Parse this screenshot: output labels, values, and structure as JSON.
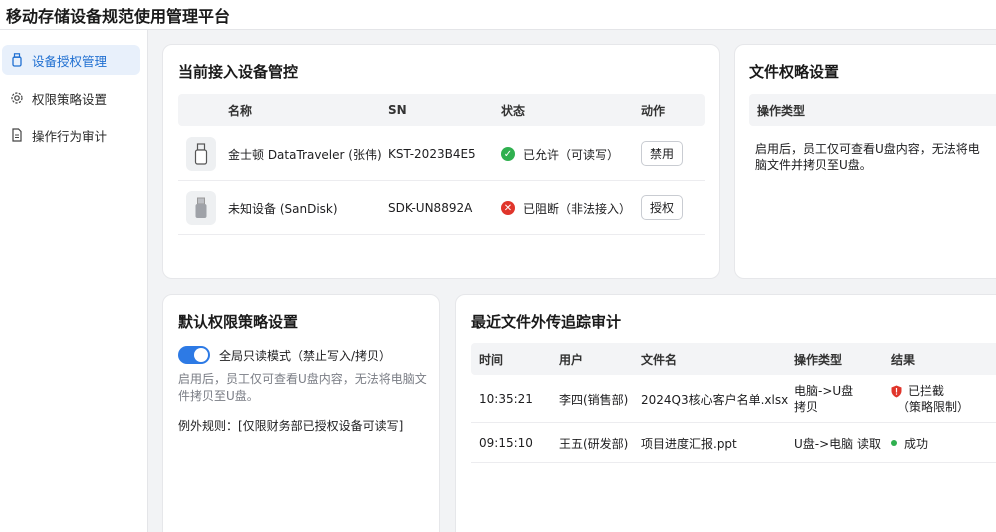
{
  "app": {
    "title": "移动存储设备规范使用管理平台"
  },
  "sidebar": {
    "items": [
      {
        "label": "设备授权管理",
        "icon": "usb-drive-icon",
        "active": true
      },
      {
        "label": "权限策略设置",
        "icon": "gear-icon",
        "active": false
      },
      {
        "label": "操作行为审计",
        "icon": "document-icon",
        "active": false
      }
    ]
  },
  "devices": {
    "title": "当前接入设备管控",
    "headers": {
      "name": "名称",
      "sn": "SN",
      "status": "状态",
      "action": "动作"
    },
    "rows": [
      {
        "name": "金士顿 DataTraveler (张伟)",
        "sn": "KST-2023B4E5",
        "status": "已允许（可读写）",
        "status_type": "allowed",
        "action": "禁用"
      },
      {
        "name": "未知设备 (SanDisk)",
        "sn": "SDK-UN8892A",
        "status": "已阻断（非法接入）",
        "status_type": "blocked",
        "action": "授权"
      }
    ]
  },
  "file_policy": {
    "title": "文件权略设置",
    "header": "操作类型",
    "description": "启用后，员工仅可查看U盘内容，无法将电脑文件并拷贝至U盘。"
  },
  "default_policy": {
    "title": "默认权限策略设置",
    "toggle_label": "全局只读模式（禁止写入/拷贝）",
    "toggle_on": true,
    "description": "启用后，员工仅可查看U盘内容，无法将电脑文件拷贝至U盘。",
    "exception": "例外规则：[仅限财务部已授权设备可读写]"
  },
  "audit": {
    "title": "最近文件外传追踪审计",
    "headers": {
      "time": "时间",
      "user": "用户",
      "file": "文件名",
      "op": "操作类型",
      "result": "结果"
    },
    "rows": [
      {
        "time": "10:35:21",
        "user": "李四(销售部)",
        "file": "2024Q3核心客户名单.xlsx",
        "op_line1": "电脑->U盘",
        "op_line2": "拷贝",
        "result_line1": "已拦截",
        "result_line2": "（策略限制）",
        "result_type": "blocked"
      },
      {
        "time": "09:15:10",
        "user": "王五(研发部)",
        "file": "项目进度汇报.ppt",
        "op_line1": "U盘->电脑 读取",
        "op_line2": "",
        "result_line1": "成功",
        "result_line2": "",
        "result_type": "success"
      }
    ]
  },
  "colors": {
    "accent": "#2d7ae5",
    "allowed": "#2fb04f",
    "blocked": "#e0352b",
    "success": "#2fb04f"
  }
}
